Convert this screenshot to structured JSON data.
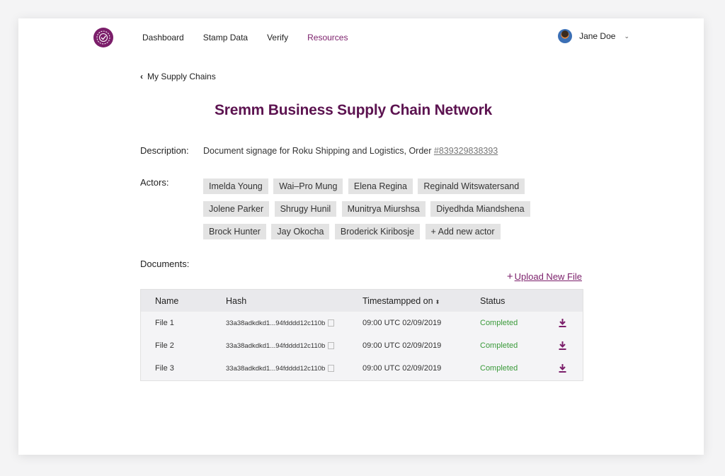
{
  "nav": {
    "items": [
      {
        "label": "Dashboard",
        "active": false
      },
      {
        "label": "Stamp Data",
        "active": false
      },
      {
        "label": "Verify",
        "active": false
      },
      {
        "label": "Resources",
        "active": true
      }
    ],
    "user_name": "Jane Doe"
  },
  "back_label": "My Supply Chains",
  "page_title": "Sremm Business Supply Chain Network",
  "description": {
    "label": "Description:",
    "text": "Document signage for Roku Shipping and Logistics, Order ",
    "order_link": "#839329838393"
  },
  "actors": {
    "label": "Actors:",
    "names": [
      "Imelda Young",
      "Wai–Pro Mung",
      "Elena Regina",
      "Reginald Witswatersand",
      "Jolene Parker",
      "Shrugy Hunil",
      "Munitrya Miurshsa",
      "Diyedhda Miandshena",
      "Brock Hunter",
      "Jay Okocha",
      "Broderick Kiribosje"
    ],
    "add_label": "Add new actor"
  },
  "documents": {
    "label": "Documents:",
    "upload_label": "Upload New File",
    "columns": [
      "Name",
      "Hash",
      "Timestampped on",
      "Status"
    ],
    "rows": [
      {
        "name": "File 1",
        "hash": "33a38adkdkd1...94fdddd12c110b",
        "time": "09:00 UTC 02/09/2019",
        "status": "Completed"
      },
      {
        "name": "File 2",
        "hash": "33a38adkdkd1...94fdddd12c110b",
        "time": "09:00 UTC 02/09/2019",
        "status": "Completed"
      },
      {
        "name": "File 3",
        "hash": "33a38adkdkd1...94fdddd12c110b",
        "time": "09:00 UTC 02/09/2019",
        "status": "Completed"
      }
    ]
  },
  "colors": {
    "brand": "#7b1e6a",
    "title": "#5c1350",
    "status_ok": "#3a9a3a",
    "chip_bg": "#e3e3e3"
  },
  "icons": [
    "logo-seal-icon",
    "chevron-left-icon",
    "chevron-down-icon",
    "plus-icon",
    "copy-icon",
    "sort-icon",
    "download-icon"
  ]
}
